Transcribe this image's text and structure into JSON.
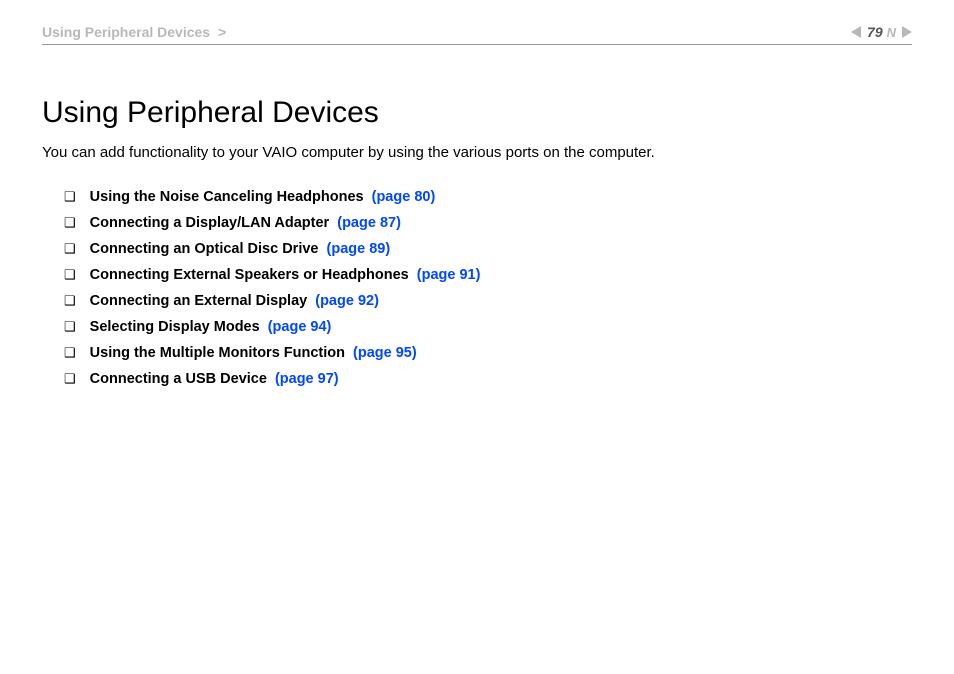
{
  "header": {
    "breadcrumb_text": "Using Peripheral Devices",
    "breadcrumb_chevron": ">",
    "page_number": "79",
    "n_mark": "N"
  },
  "content": {
    "title": "Using Peripheral Devices",
    "intro": "You can add functionality to your VAIO computer by using the various ports on the computer."
  },
  "toc": [
    {
      "bullet": "❑",
      "label": "Using the Noise Canceling Headphones",
      "page_link": "(page 80)"
    },
    {
      "bullet": "❑",
      "label": "Connecting a Display/LAN Adapter",
      "page_link": "(page 87)"
    },
    {
      "bullet": "❑",
      "label": "Connecting an Optical Disc Drive",
      "page_link": "(page 89)"
    },
    {
      "bullet": "❑",
      "label": "Connecting External Speakers or Headphones",
      "page_link": "(page 91)"
    },
    {
      "bullet": "❑",
      "label": "Connecting an External Display",
      "page_link": "(page 92)"
    },
    {
      "bullet": "❑",
      "label": "Selecting Display Modes",
      "page_link": "(page 94)"
    },
    {
      "bullet": "❑",
      "label": "Using the Multiple Monitors Function",
      "page_link": "(page 95)"
    },
    {
      "bullet": "❑",
      "label": "Connecting a USB Device",
      "page_link": "(page 97)"
    }
  ]
}
